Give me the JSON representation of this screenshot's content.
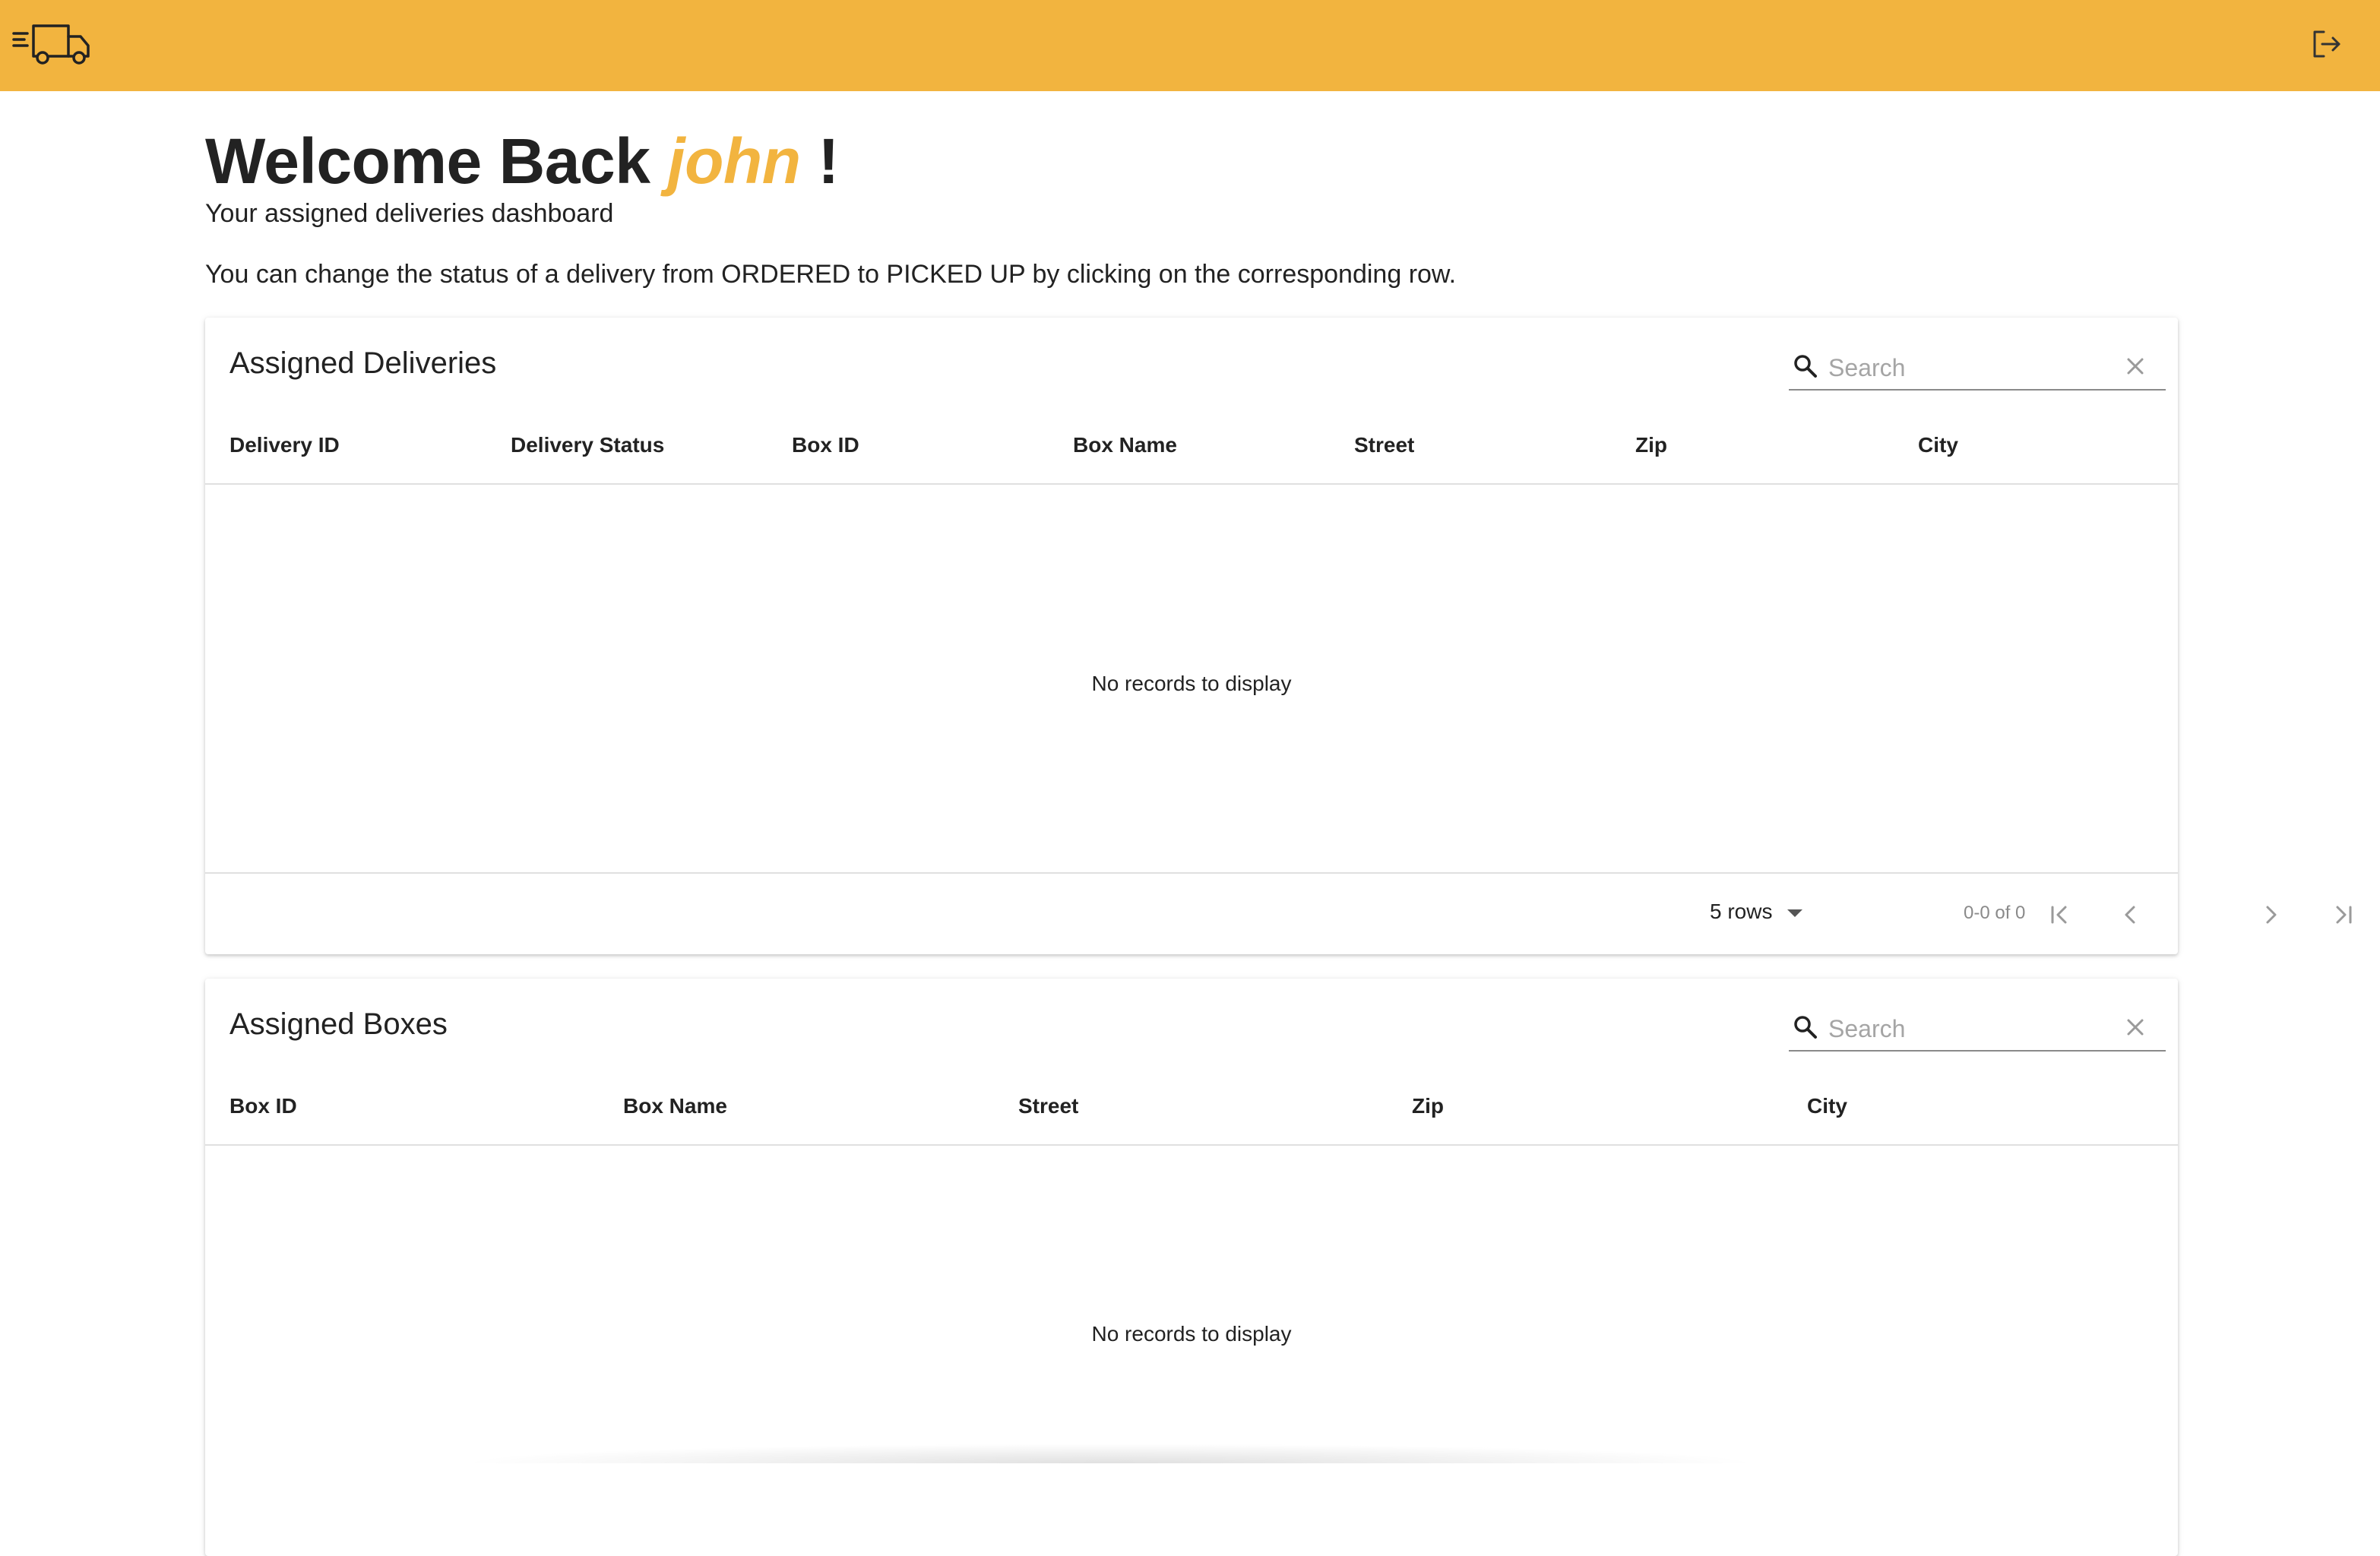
{
  "header": {
    "logo_icon": "delivery-truck-icon",
    "logout_icon": "logout-icon",
    "background_color": "#f2b43f"
  },
  "welcome": {
    "prefix": "Welcome Back ",
    "username": "john",
    "suffix": " !",
    "subtitle": "Your assigned deliveries dashboard",
    "info": "You can change the status of a delivery from ORDERED to PICKED UP by clicking on the corresponding row."
  },
  "deliveries": {
    "title": "Assigned Deliveries",
    "search_placeholder": "Search",
    "columns": [
      "Delivery ID",
      "Delivery Status",
      "Box ID",
      "Box Name",
      "Street",
      "Zip",
      "City"
    ],
    "empty_text": "No records to display",
    "pagination": {
      "rows_label": "5 rows",
      "range_text": "0-0 of 0"
    }
  },
  "boxes": {
    "title": "Assigned Boxes",
    "search_placeholder": "Search",
    "columns": [
      "Box ID",
      "Box Name",
      "Street",
      "Zip",
      "City"
    ],
    "empty_text": "No records to display"
  }
}
